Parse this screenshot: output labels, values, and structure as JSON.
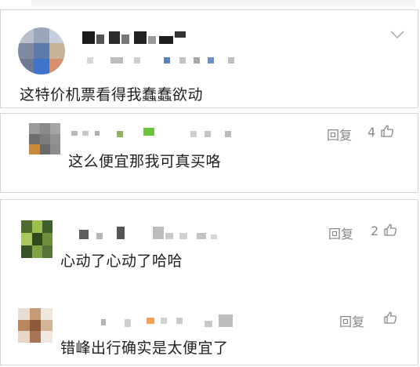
{
  "comments": [
    {
      "text": "这特价机票看得我蠢蠢欲动",
      "has_menu": true
    },
    {
      "text": "这么便宜那我可真买咯",
      "reply_label": "回复",
      "likes": "4"
    },
    {
      "text": "心动了心动了哈哈",
      "reply_label": "回复",
      "likes": "2"
    },
    {
      "text": "错峰出行确实是太便宜了",
      "reply_label": "回复",
      "likes": ""
    }
  ],
  "colors": {
    "text": "#1f1f1f",
    "meta": "#888888",
    "border": "#d6d6d6"
  },
  "icons": [
    "chevron-down-icon",
    "thumbs-up-icon"
  ]
}
